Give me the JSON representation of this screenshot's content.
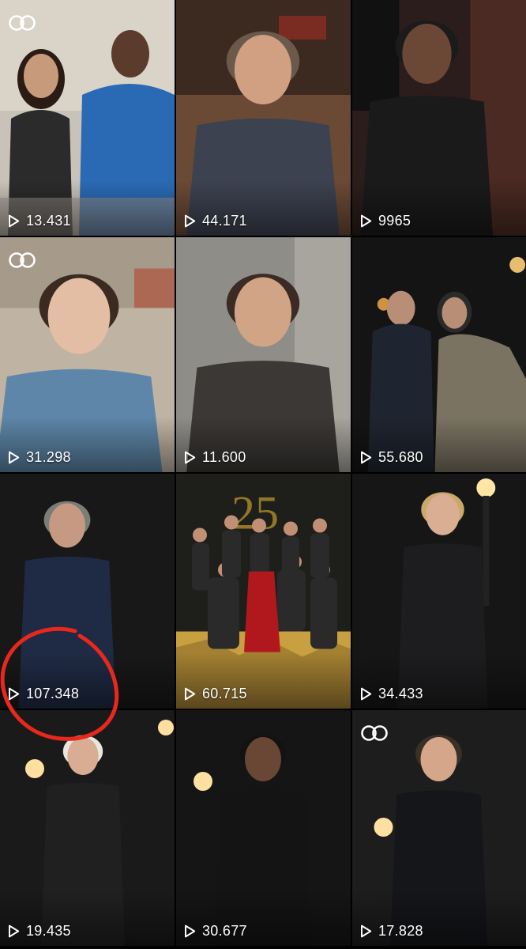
{
  "grid": {
    "videos": [
      {
        "views": "13.431",
        "collab": true,
        "bg": "#c9c2b8",
        "skin": "#c89a7c",
        "outfit": "#2a6ab5"
      },
      {
        "views": "44.171",
        "collab": false,
        "bg": "#6b4a35",
        "skin": "#d1a083",
        "outfit": "#3d4250"
      },
      {
        "views": "9965",
        "collab": false,
        "bg": "#2b1d1b",
        "skin": "#6b4735",
        "outfit": "#1a1a1a"
      },
      {
        "views": "31.298",
        "collab": true,
        "bg": "#bfb3a3",
        "skin": "#e4bea4",
        "outfit": "#5d86a8"
      },
      {
        "views": "11.600",
        "collab": false,
        "bg": "#8f8d88",
        "skin": "#d2a486",
        "outfit": "#3b3835"
      },
      {
        "views": "55.680",
        "collab": false,
        "bg": "#141414",
        "skin": "#b98e76",
        "outfit": "#7a7362"
      },
      {
        "views": "107.348",
        "collab": false,
        "bg": "#181818",
        "skin": "#c69a82",
        "outfit": "#1f2a44"
      },
      {
        "views": "60.715",
        "collab": false,
        "bg": "#3a3a32",
        "skin": "#c19074",
        "outfit": "#b0181e"
      },
      {
        "views": "34.433",
        "collab": false,
        "bg": "#161616",
        "skin": "#d9ae92",
        "outfit": "#1d1d1f"
      },
      {
        "views": "19.435",
        "collab": false,
        "bg": "#1a1a1a",
        "skin": "#d8ad93",
        "outfit": "#202020"
      },
      {
        "views": "30.677",
        "collab": false,
        "bg": "#151515",
        "skin": "#6a4734",
        "outfit": "#141414"
      },
      {
        "views": "17.828",
        "collab": true,
        "bg": "#1d1d1d",
        "skin": "#d5a68a",
        "outfit": "#15161a"
      }
    ]
  },
  "annotation": {
    "color": "#e8281c",
    "target_views": "107.348"
  },
  "icons": {
    "play": "play-icon",
    "collab": "collab-icon"
  }
}
